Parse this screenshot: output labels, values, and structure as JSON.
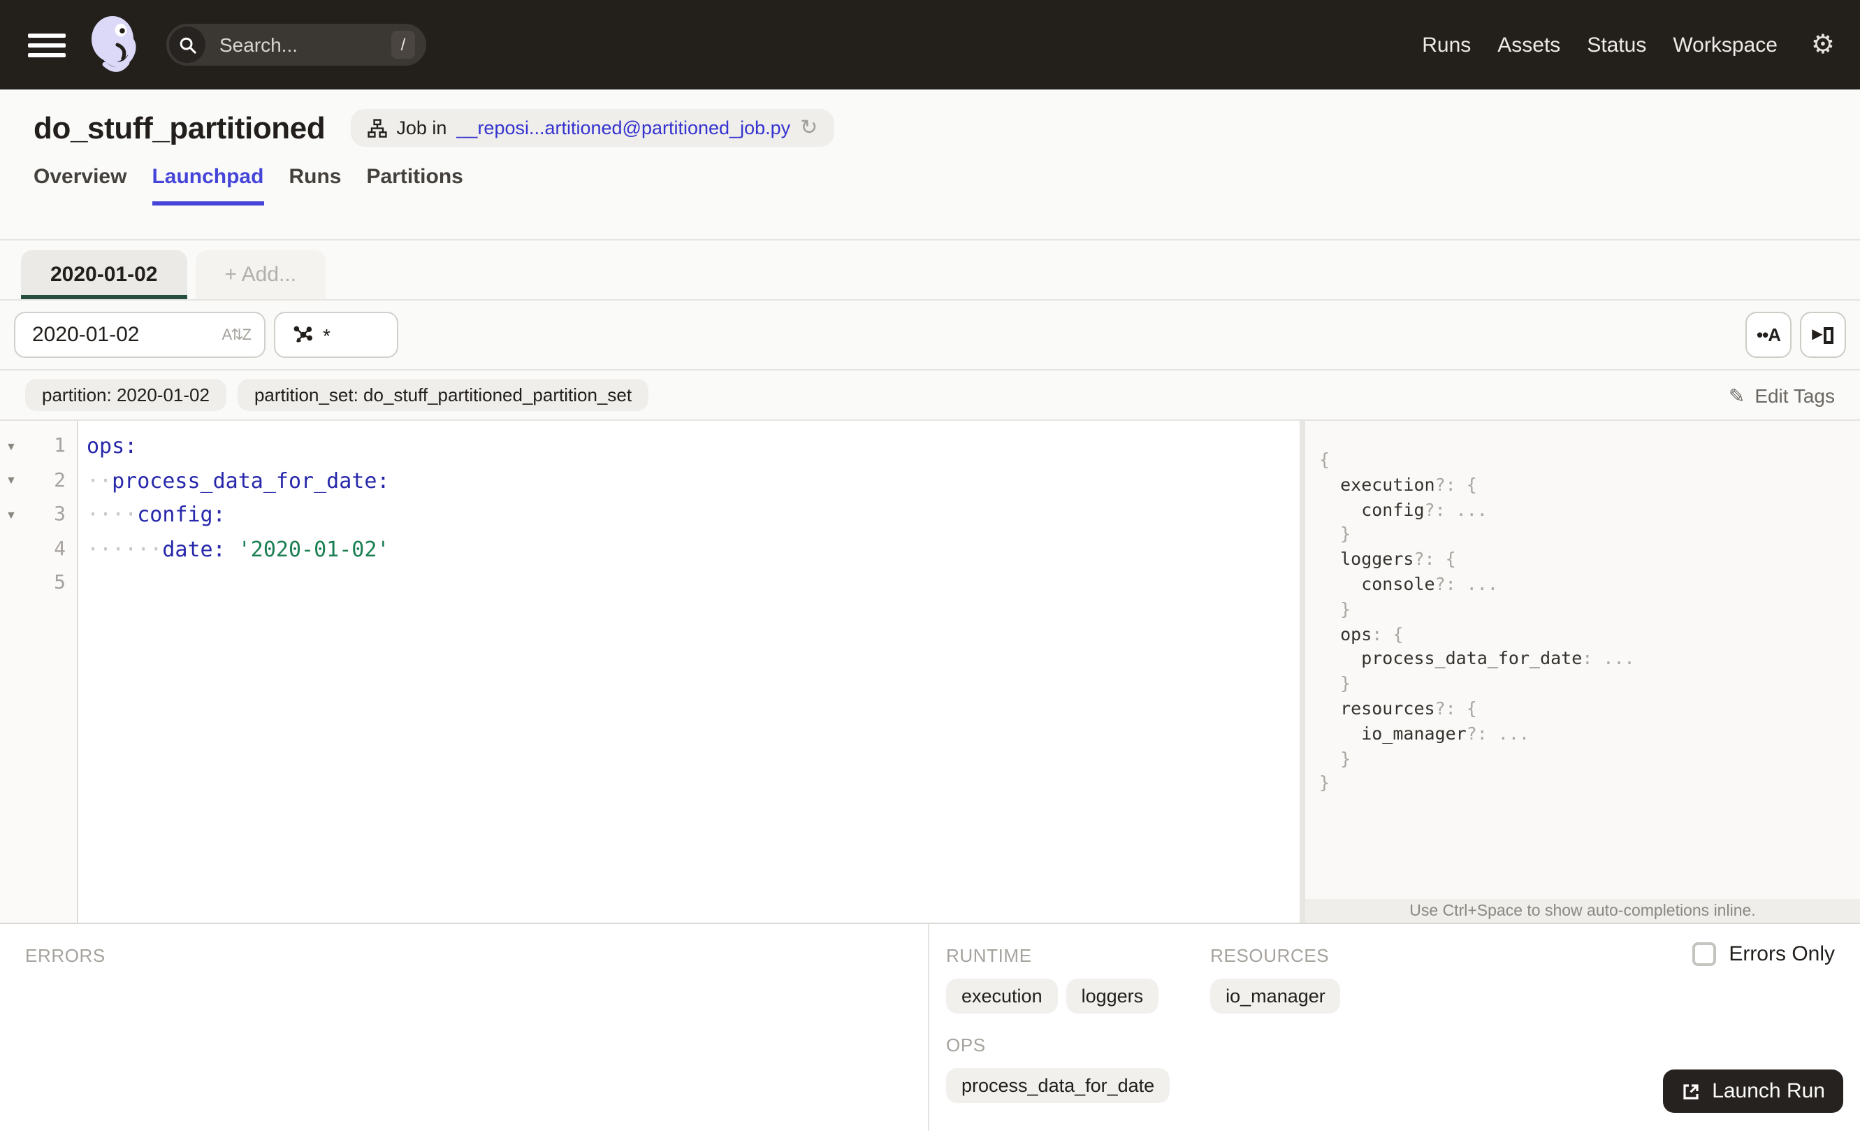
{
  "colors": {
    "topbar_bg": "#231f1b",
    "accent_blue": "#4645d9",
    "link_blue": "#3533cf",
    "code_key": "#2727ab",
    "code_string": "#1a7f52",
    "partition_tab_underline": "#254f40",
    "dark_button": "#262220",
    "logo_lavender": "#dcd9f8"
  },
  "topbar": {
    "menu_icon": "hamburger",
    "logo_icon": "dagster-octopus",
    "search": {
      "placeholder": "Search...",
      "shortcut": "/"
    },
    "nav": [
      {
        "label": "Runs"
      },
      {
        "label": "Assets"
      },
      {
        "label": "Status"
      },
      {
        "label": "Workspace"
      }
    ],
    "settings_icon": "⚙"
  },
  "header": {
    "title": "do_stuff_partitioned",
    "job_prefix": "Job in",
    "job_link": "__reposi...artitioned@partitioned_job.py",
    "refresh_icon": "↻"
  },
  "tabs": [
    {
      "label": "Overview"
    },
    {
      "label": "Launchpad"
    },
    {
      "label": "Runs"
    },
    {
      "label": "Partitions"
    }
  ],
  "config_tabs": {
    "active": "2020-01-02",
    "add": "+ Add..."
  },
  "filters": {
    "partition_value": "2020-01-02",
    "sort_icon": "A⇅Z",
    "op_query": "*"
  },
  "editor_buttons": {
    "autocomplete": "••A",
    "panel_toggle": "▶"
  },
  "tags": {
    "items": [
      {
        "text": "partition: 2020-01-02"
      },
      {
        "text": "partition_set: do_stuff_partitioned_partition_set"
      }
    ],
    "edit_label": "Edit Tags",
    "edit_icon": "✎"
  },
  "editor": {
    "fold_icon": "▼",
    "line_numbers": [
      "1",
      "2",
      "3",
      "4",
      "5"
    ],
    "line1": {
      "key": "ops:"
    },
    "line2": {
      "ws": "··",
      "key": "process_data_for_date:"
    },
    "line3": {
      "ws": "····",
      "key": "config:"
    },
    "line4": {
      "ws": "······",
      "key": "date:",
      "sep": " ",
      "str": "'2020-01-02'"
    }
  },
  "schema": {
    "lines": [
      {
        "k": "",
        "p": "{"
      },
      {
        "k": "  execution",
        "p": "?: {"
      },
      {
        "k": "    config",
        "p": "?: ..."
      },
      {
        "k": "  ",
        "p": "}"
      },
      {
        "k": "  loggers",
        "p": "?: {"
      },
      {
        "k": "    console",
        "p": "?: ..."
      },
      {
        "k": "  ",
        "p": "}"
      },
      {
        "k": "  ops",
        "p": ": {"
      },
      {
        "k": "    process_data_for_date",
        "p": ": ..."
      },
      {
        "k": "  ",
        "p": "}"
      },
      {
        "k": "  resources",
        "p": "?: {"
      },
      {
        "k": "    io_manager",
        "p": "?: ..."
      },
      {
        "k": "  ",
        "p": "}"
      },
      {
        "k": "",
        "p": "}"
      }
    ],
    "hint": "Use Ctrl+Space to show auto-completions inline."
  },
  "bottom": {
    "errors_label": "ERRORS",
    "runtime_label": "RUNTIME",
    "resources_label": "RESOURCES",
    "ops_label": "OPS",
    "runtime_tags": [
      {
        "label": "execution"
      },
      {
        "label": "loggers"
      }
    ],
    "resources_tags": [
      {
        "label": "io_manager"
      }
    ],
    "ops_tags": [
      {
        "label": "process_data_for_date"
      }
    ],
    "errors_only_label": "Errors Only",
    "launch_label": "Launch Run"
  }
}
